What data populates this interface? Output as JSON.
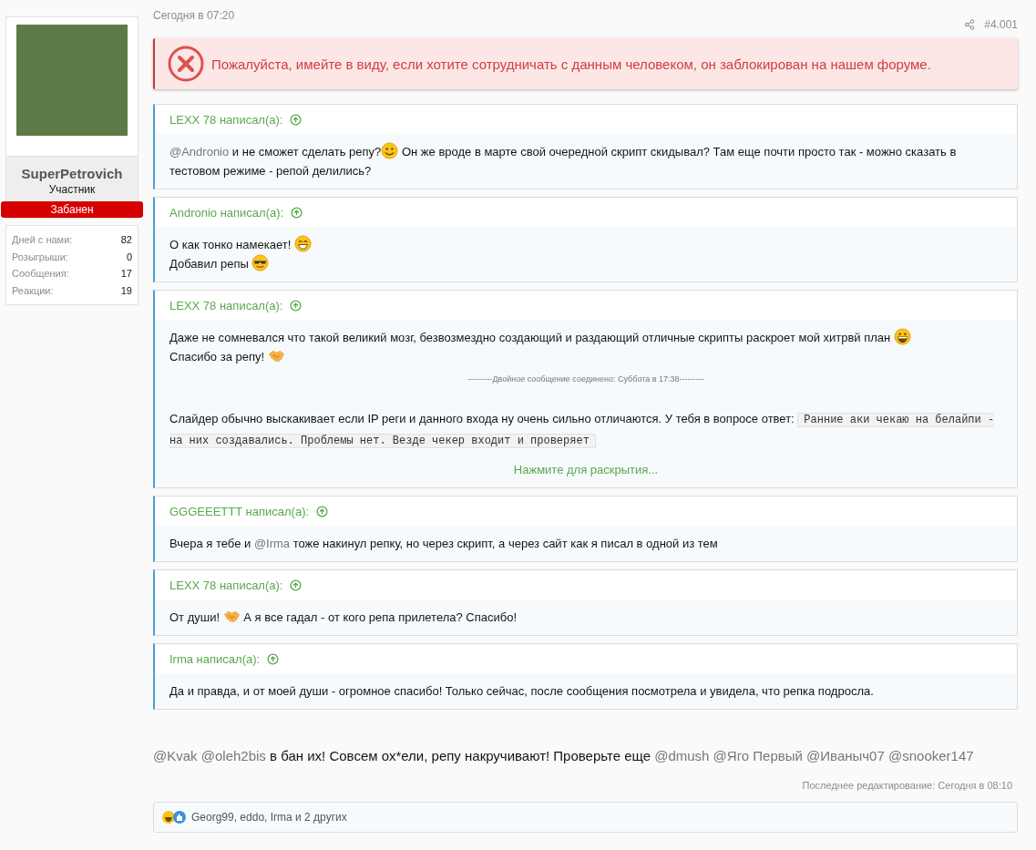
{
  "author": {
    "name": "SuperPetrovich",
    "role": "Участник",
    "banner": "Забанен",
    "stats": [
      {
        "label": "Дней с нами:",
        "value": "82"
      },
      {
        "label": "Розыгрыши:",
        "value": "0"
      },
      {
        "label": "Сообщения:",
        "value": "17"
      },
      {
        "label": "Реакции:",
        "value": "19"
      }
    ]
  },
  "post": {
    "date": "Сегодня в 07:20",
    "number": "#4.001",
    "alert": "Пожалуйста, имейте в виду, если хотите сотрудничать с данным человеком, он заблокирован на нашем форуме.",
    "quotes": [
      {
        "header": "LEXX 78 написал(а):",
        "paragraphs": [
          {
            "kind": "text",
            "segments": [
              {
                "kind": "mention",
                "text": "@Andronio"
              },
              {
                "kind": "text",
                "text": " и не сможет сделать репу?"
              },
              {
                "kind": "emoji-smile"
              },
              {
                "kind": "text",
                "text": " Он же вроде в марте свой очередной скрипт скидывал? Там еще почти просто так - можно сказать в тестовом режиме - репой делились?"
              }
            ]
          }
        ]
      },
      {
        "header": "Andronio написал(а):",
        "paragraphs": [
          {
            "kind": "text",
            "segments": [
              {
                "kind": "text",
                "text": "О как тонко намекает! "
              },
              {
                "kind": "emoji-grin"
              }
            ]
          },
          {
            "kind": "text",
            "segments": [
              {
                "kind": "text",
                "text": "Добавил репы "
              },
              {
                "kind": "emoji-cool"
              }
            ]
          }
        ]
      },
      {
        "header": "LEXX 78 написал(а):",
        "paragraphs": [
          {
            "kind": "text",
            "segments": [
              {
                "kind": "text",
                "text": "Даже не сомневался что такой великий мозг, безвозмездно создающий и раздающий отличные скрипты раскроет мой хитрвй план "
              },
              {
                "kind": "emoji-laugh"
              }
            ]
          },
          {
            "kind": "text",
            "segments": [
              {
                "kind": "text",
                "text": "Спасибо за репу! "
              },
              {
                "kind": "emoji-handshake"
              }
            ]
          },
          {
            "kind": "merge-note",
            "text": "---------Двойное сообщение соединено: Суббота в 17:38---------"
          },
          {
            "kind": "text",
            "segments": [
              {
                "kind": "text",
                "text": "Слайдер обычно выскакивает если IP реги и данного входа ну очень сильно отличаются. У тебя в вопросе ответ: "
              },
              {
                "kind": "code",
                "text": "Ранние аки чекаю на белайпи - на них создавались. Проблемы нет. Везде чекер входит и проверяет"
              }
            ]
          }
        ],
        "expand": "Нажмите для раскрытия..."
      },
      {
        "header": "GGGEEETTT написал(а):",
        "paragraphs": [
          {
            "kind": "text",
            "segments": [
              {
                "kind": "text",
                "text": "Вчера я тебе и "
              },
              {
                "kind": "mention",
                "text": "@Irma"
              },
              {
                "kind": "text",
                "text": " тоже накинул репку, но через скрипт, а через сайт как я писал в одной из тем"
              }
            ]
          }
        ]
      },
      {
        "header": "LEXX 78 написал(а):",
        "paragraphs": [
          {
            "kind": "text",
            "segments": [
              {
                "kind": "text",
                "text": "От души! "
              },
              {
                "kind": "emoji-handshake"
              },
              {
                "kind": "text",
                "text": " А я все гадал - от кого репа прилетела? Спасибо!"
              }
            ]
          }
        ]
      },
      {
        "header": "Irma написал(а):",
        "paragraphs": [
          {
            "kind": "text",
            "segments": [
              {
                "kind": "text",
                "text": "Да и правда, и от моей души - огромное спасибо! Только сейчас, после сообщения посмотрела и увидела, что репка подросла."
              }
            ]
          }
        ]
      }
    ],
    "message": [
      {
        "kind": "mention",
        "text": "@Kvak"
      },
      {
        "kind": "mention",
        "text": "@oleh2bis"
      },
      {
        "kind": "text",
        "text": " в бан их! Совсем ох*ели, репу накручивают! Проверьте еще "
      },
      {
        "kind": "mention",
        "text": "@dmush"
      },
      {
        "kind": "mention",
        "text": "@Яго Первый"
      },
      {
        "kind": "mention",
        "text": "@Иваныч07"
      },
      {
        "kind": "mention",
        "text": "@snooker147"
      }
    ],
    "last_edit": "Последнее редактирование: Сегодня в 08:10",
    "reactions": "Georg99, eddo, Irma и 2 других"
  }
}
